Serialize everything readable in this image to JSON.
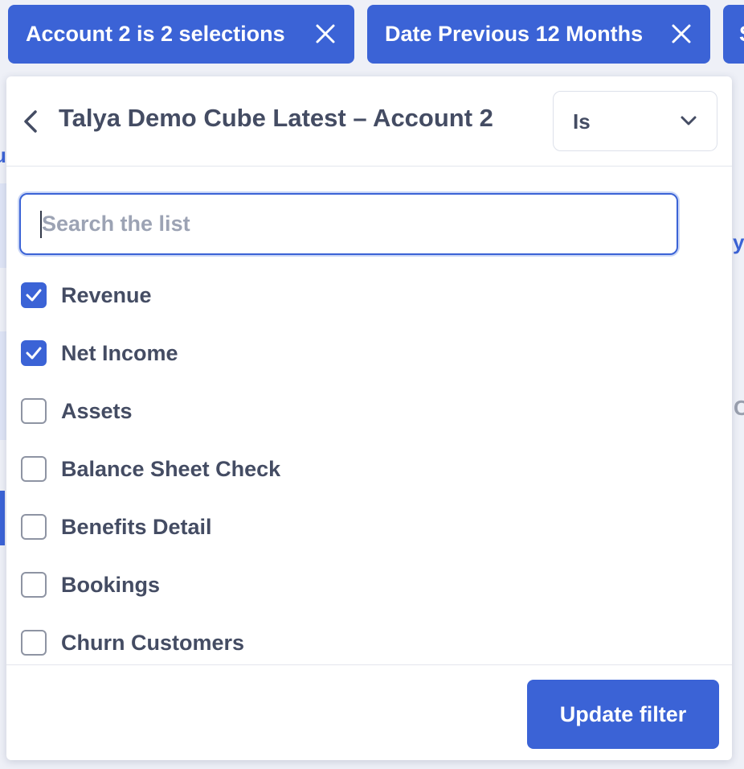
{
  "colors": {
    "accent": "#3b63d6",
    "text": "#444c63",
    "placeholder": "#9ca3b4",
    "checkbox_border": "#8e94a3",
    "page_bg": "#eef0f7"
  },
  "filter_chips": [
    {
      "label": "Account 2 is 2 selections",
      "icon": "close-icon"
    },
    {
      "label": "Date Previous 12 Months",
      "icon": "close-icon"
    },
    {
      "label": "S"
    }
  ],
  "background_fragments": [
    "u",
    "y",
    "C"
  ],
  "panel": {
    "back_icon": "chevron-left-icon",
    "title": "Talya Demo Cube Latest – Account 2",
    "operator": {
      "value": "Is",
      "icon": "chevron-down-icon"
    },
    "search": {
      "placeholder": "Search the list",
      "value": ""
    },
    "items": [
      {
        "label": "Revenue",
        "checked": true
      },
      {
        "label": "Net Income",
        "checked": true
      },
      {
        "label": "Assets",
        "checked": false
      },
      {
        "label": "Balance Sheet Check",
        "checked": false
      },
      {
        "label": "Benefits Detail",
        "checked": false
      },
      {
        "label": "Bookings",
        "checked": false
      },
      {
        "label": "Churn Customers",
        "checked": false
      }
    ],
    "footer": {
      "update_label": "Update filter"
    }
  }
}
